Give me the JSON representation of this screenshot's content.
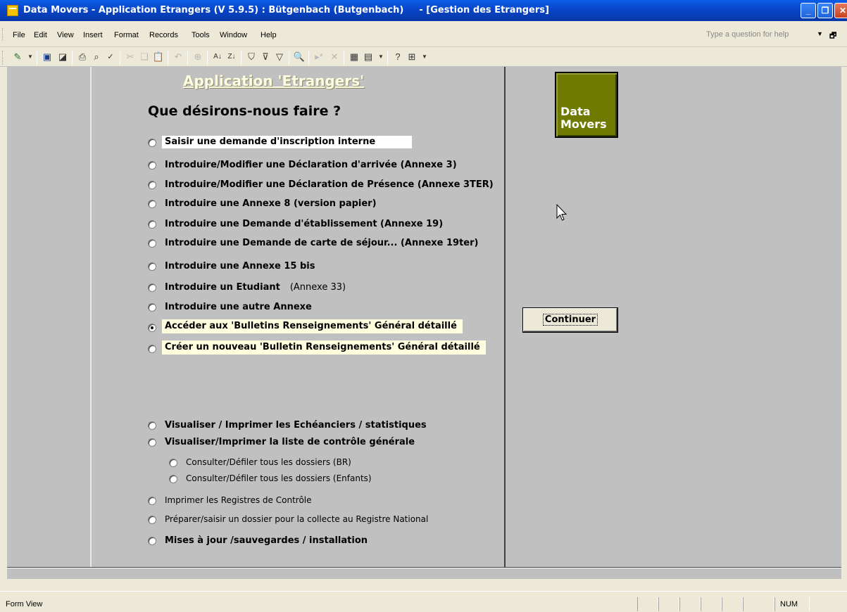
{
  "window": {
    "title": "Data Movers - Application Etrangers (V 5.9.5) : Bütgenbach (Butgenbach)",
    "document": "- [Gestion des Etrangers]"
  },
  "menu": {
    "items": [
      {
        "label": "File"
      },
      {
        "label": "Edit"
      },
      {
        "label": "View"
      },
      {
        "label": "Insert"
      },
      {
        "label": "Format"
      },
      {
        "label": "Records"
      },
      {
        "label": "Tools"
      },
      {
        "label": "Window"
      },
      {
        "label": "Help"
      }
    ],
    "help_placeholder": "Type a question for help"
  },
  "toolbar": {
    "icons": [
      "view-icon",
      "save-icon",
      "file-search-icon",
      "print-icon",
      "print-preview-icon",
      "spelling-icon",
      "cut-icon",
      "copy-icon",
      "paste-icon",
      "undo-icon",
      "hyperlink-icon",
      "sort-ascending-icon",
      "sort-descending-icon",
      "filter-by-selection-icon",
      "filter-by-form-icon",
      "apply-filter-icon",
      "find-icon",
      "new-record-icon",
      "delete-record-icon",
      "database-window-icon",
      "new-object-icon",
      "help-icon",
      "table-icon"
    ]
  },
  "form": {
    "app_title": "Application 'Etrangers'",
    "question": "Que désirons-nous faire ?",
    "options": [
      {
        "label": "Saisir une demande d'inscription interne",
        "checked": false
      },
      {
        "label": "Introduire/Modifier une Déclaration d'arrivée (Annexe 3)",
        "checked": false
      },
      {
        "label": "Introduire/Modifier une Déclaration de Présence (Annexe 3TER)",
        "checked": false
      },
      {
        "label": "Introduire une Annexe 8 (version papier)",
        "checked": false
      },
      {
        "label": "Introduire une Demande d'établissement (Annexe 19)",
        "checked": false
      },
      {
        "label": "Introduire une Demande de carte de séjour... (Annexe 19ter)",
        "checked": false
      },
      {
        "label": "Introduire une Annexe 15 bis",
        "checked": false
      },
      {
        "label": "Introduire un Etudiant",
        "aside": "(Annexe 33)",
        "checked": false
      },
      {
        "label": "Introduire une autre Annexe",
        "checked": false
      },
      {
        "label": "Accéder aux 'Bulletins Renseignements' Général détaillé",
        "checked": true
      },
      {
        "label": "Créer un nouveau 'Bulletin Renseignements' Général détaillé",
        "checked": false
      },
      {
        "label": "Visualiser / Imprimer les Echéanciers / statistiques",
        "checked": false
      },
      {
        "label": "Visualiser/Imprimer la liste de contrôle générale",
        "checked": false
      },
      {
        "label": "Consulter/Défiler tous les dossiers (BR)",
        "checked": false
      },
      {
        "label": "Consulter/Défiler tous les dossiers (Enfants)",
        "checked": false
      },
      {
        "label": "Imprimer les Registres de Contrôle",
        "checked": false
      },
      {
        "label": "Préparer/saisir un dossier pour la collecte au Registre National",
        "checked": false
      },
      {
        "label": "Mises à jour /sauvegardes / installation",
        "checked": false
      }
    ],
    "logo": {
      "line1": "Data",
      "line2": "Movers",
      "color": "#6e7a00"
    },
    "continue_label": "Continuer"
  },
  "status": {
    "mode": "Form View",
    "num": "NUM"
  }
}
